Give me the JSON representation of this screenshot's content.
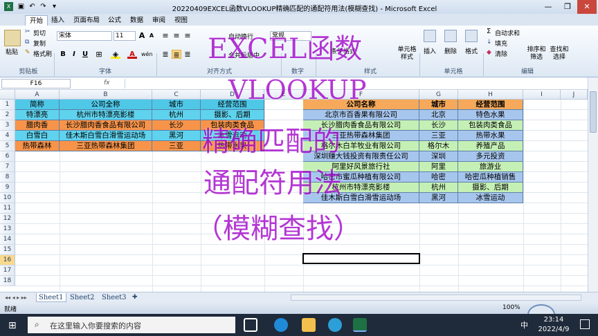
{
  "window": {
    "title": "20220409EXCEL函数VLOOKUP精确匹配的通配符用法(模糊查找) - Microsoft Excel",
    "controls": [
      "—",
      "❐",
      "✕"
    ]
  },
  "ribbon_tabs": [
    "开始",
    "插入",
    "页面布局",
    "公式",
    "数据",
    "审阅",
    "视图"
  ],
  "clipboard": {
    "cut": "剪切",
    "copy": "复制",
    "painter": "格式刷",
    "paste": "粘贴",
    "group": "剪贴板"
  },
  "font": {
    "name": "宋体",
    "size": "11",
    "group": "字体",
    "bold": "B",
    "italic": "I",
    "underline": "U",
    "grow": "A",
    "shrink": "A",
    "wen": "wén"
  },
  "alignment": {
    "wrap": "自动换行",
    "merge": "合并后居中",
    "group": "对齐方式"
  },
  "number": {
    "format": "常规",
    "group": "数字"
  },
  "styles": {
    "cond": "条件格式",
    "table": "套用表格格式",
    "cell": "单元格样式",
    "group": "样式"
  },
  "cells": {
    "insert": "插入",
    "delete": "删除",
    "format": "格式",
    "group": "单元格"
  },
  "editing": {
    "autosum": "自动求和",
    "fill": "填充",
    "clear": "清除",
    "sort": "排序和筛选",
    "find": "查找和选择",
    "group": "编辑"
  },
  "formula_bar": {
    "name_box": "F16",
    "fx": "fx",
    "formula": ""
  },
  "columns": [
    "A",
    "B",
    "C",
    "D",
    "E",
    "F",
    "G",
    "H",
    "I",
    "J"
  ],
  "rows": [
    "1",
    "2",
    "3",
    "4",
    "5",
    "6",
    "7",
    "8",
    "9",
    "10",
    "11",
    "12",
    "13",
    "14",
    "15",
    "16",
    "17",
    "18"
  ],
  "left_table": {
    "headers": [
      "简称",
      "公司全称",
      "城市",
      "经营范围"
    ],
    "rows": [
      [
        "特漂亮",
        "杭州市特漂亮影楼",
        "杭州",
        "摄影、后期"
      ],
      [
        "腊肉香",
        "长沙腊肉香食品有限公司",
        "长沙",
        "包装肉类食品"
      ],
      [
        "白雪白",
        "佳木斯白雪白滑雪运动场",
        "黑河",
        "冰雪运动"
      ],
      [
        "热带森林",
        "三亚热带森林集团",
        "三亚",
        "热带水果"
      ]
    ]
  },
  "right_table": {
    "headers": [
      "公司名称",
      "城市",
      "经营范围"
    ],
    "rows": [
      [
        "北京市百香果有限公司",
        "北京",
        "特色水果"
      ],
      [
        "长沙腊肉香食品有限公司",
        "长沙",
        "包装肉类食品"
      ],
      [
        "三亚热带森林集团",
        "三亚",
        "热带水果"
      ],
      [
        "格尔木白羊牧业有限公司",
        "格尔木",
        "养殖产品"
      ],
      [
        "深圳赚大钱投资有限责任公司",
        "深圳",
        "多元投资"
      ],
      [
        "阿里好风景旅行社",
        "阿里",
        "旅游业"
      ],
      [
        "哈密市蜜瓜种植有限公司",
        "哈密",
        "哈密瓜种植销售"
      ],
      [
        "杭州市特漂亮影楼",
        "杭州",
        "摄影、后期"
      ],
      [
        "佳木斯白雪白滑雪运动场",
        "黑河",
        "冰雪运动"
      ]
    ]
  },
  "watermark": [
    "EXCEL函数",
    "VLOOKUP",
    "精确匹配的",
    "通配符用法",
    "（模糊查找）"
  ],
  "sheets": [
    "Sheet1",
    "Sheet2",
    "Sheet3"
  ],
  "status": {
    "mode": "就绪",
    "zoom": "100%"
  },
  "taskbar": {
    "search_placeholder": "在这里输入你要搜索的内容",
    "time": "23:14",
    "date": "2022/4/9",
    "ime": "中"
  },
  "colors": {
    "left_header": "#4fc8e8",
    "left_row_cyan": "#5fd3ee",
    "left_row_orange": "#f7944a",
    "right_header": "#f6a95a",
    "right_row_blue": "#a7c6ee",
    "right_row_green": "#c5f0b5",
    "watermark": "#a000c8"
  }
}
